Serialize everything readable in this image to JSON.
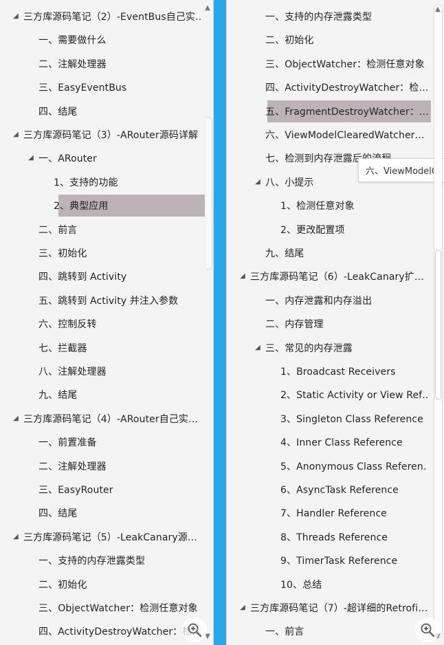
{
  "left_panel": {
    "items": [
      {
        "label": "三方库源码笔记（2）-EventBus自己实…",
        "level": 0,
        "expanded": true
      },
      {
        "label": "一、需要做什么",
        "level": 1
      },
      {
        "label": "二、注解处理器",
        "level": 1
      },
      {
        "label": "三、EasyEventBus",
        "level": 1
      },
      {
        "label": "四、结尾",
        "level": 1
      },
      {
        "label": "三方库源码笔记（3）-ARouter源码详解",
        "level": 0,
        "expanded": true
      },
      {
        "label": "一、ARouter",
        "level": 1,
        "expanded": true
      },
      {
        "label": "1、支持的功能",
        "level": 2
      },
      {
        "label": "2、典型应用",
        "level": 2,
        "selected": true
      },
      {
        "label": "二、前言",
        "level": 1
      },
      {
        "label": "三、初始化",
        "level": 1
      },
      {
        "label": "四、跳转到 Activity",
        "level": 1
      },
      {
        "label": "五、跳转到 Activity 并注入参数",
        "level": 1
      },
      {
        "label": "六、控制反转",
        "level": 1
      },
      {
        "label": "七、拦截器",
        "level": 1
      },
      {
        "label": "八、注解处理器",
        "level": 1
      },
      {
        "label": "九、结尾",
        "level": 1
      },
      {
        "label": "三方库源码笔记（4）-ARouter自己实…",
        "level": 0,
        "expanded": true
      },
      {
        "label": "一、前置准备",
        "level": 1
      },
      {
        "label": "二、注解处理器",
        "level": 1
      },
      {
        "label": "三、EasyRouter",
        "level": 1
      },
      {
        "label": "四、结尾",
        "level": 1
      },
      {
        "label": "三方库源码笔记（5）-LeakCanary源…",
        "level": 0,
        "expanded": true
      },
      {
        "label": "一、支持的内存泄露类型",
        "level": 1
      },
      {
        "label": "二、初始化",
        "level": 1
      },
      {
        "label": "三、ObjectWatcher：检测任意对象",
        "level": 1
      },
      {
        "label": "四、ActivityDestroyWatcher：检…",
        "level": 1
      }
    ]
  },
  "right_panel": {
    "items": [
      {
        "label": "一、支持的内存泄露类型",
        "level": 1
      },
      {
        "label": "二、初始化",
        "level": 1
      },
      {
        "label": "三、ObjectWatcher：检测任意对象",
        "level": 1
      },
      {
        "label": "四、ActivityDestroyWatcher：检…",
        "level": 1
      },
      {
        "label": "五、FragmentDestroyWatcher：…",
        "level": 1,
        "selected": true
      },
      {
        "label": "六、ViewModelClearedWatcher…",
        "level": 1
      },
      {
        "label": "七、检测到内存泄露后的流程",
        "level": 1
      },
      {
        "label": "八、小提示",
        "level": 1,
        "expanded": true
      },
      {
        "label": "1、检测任意对象",
        "level": 2
      },
      {
        "label": "2、更改配置项",
        "level": 2
      },
      {
        "label": "九、结尾",
        "level": 1
      },
      {
        "label": "三方库源码笔记（6）-LeakCanary扩…",
        "level": 0,
        "expanded": true
      },
      {
        "label": "一、内存泄露和内存溢出",
        "level": 1
      },
      {
        "label": "二、内存管理",
        "level": 1
      },
      {
        "label": "三、常见的内存泄露",
        "level": 1,
        "expanded": true
      },
      {
        "label": "1、Broadcast Receivers",
        "level": 2
      },
      {
        "label": "2、Static Activity or View Ref…",
        "level": 2
      },
      {
        "label": "3、Singleton Class Reference",
        "level": 2
      },
      {
        "label": "4、Inner Class Reference",
        "level": 2
      },
      {
        "label": "5、Anonymous Class Referen…",
        "level": 2
      },
      {
        "label": "6、AsyncTask Reference",
        "level": 2
      },
      {
        "label": "7、Handler Reference",
        "level": 2
      },
      {
        "label": "8、Threads Reference",
        "level": 2
      },
      {
        "label": "9、TimerTask Reference",
        "level": 2
      },
      {
        "label": "10、总结",
        "level": 2
      },
      {
        "label": "三方库源码笔记（7）-超详细的Retrofi…",
        "level": 0,
        "expanded": true
      },
      {
        "label": "一、前言",
        "level": 1
      }
    ],
    "tooltip": "六、ViewModelCl"
  },
  "colors": {
    "background": "#2aa6e4",
    "panel": "#f4f4f4",
    "selected": "#bdb2b8",
    "text": "#222222"
  },
  "icons": {
    "expanded_caret": "caret-down-icon",
    "zoom": "zoom-in-icon"
  }
}
